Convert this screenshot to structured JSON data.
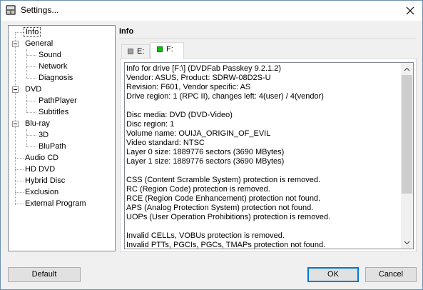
{
  "window": {
    "title": "Settings...",
    "close_label": "close"
  },
  "tree": {
    "items": [
      {
        "label": "Info",
        "selected": true
      },
      {
        "label": "General"
      },
      {
        "label": "Sound"
      },
      {
        "label": "Network"
      },
      {
        "label": "Diagnosis"
      },
      {
        "label": "DVD"
      },
      {
        "label": "PathPlayer"
      },
      {
        "label": "Subtitles"
      },
      {
        "label": "Blu-ray"
      },
      {
        "label": "3D"
      },
      {
        "label": "BluPath"
      },
      {
        "label": "Audio CD"
      },
      {
        "label": "HD DVD"
      },
      {
        "label": "Hybrid Disc"
      },
      {
        "label": "Exclusion"
      },
      {
        "label": "External Program"
      }
    ]
  },
  "panel": {
    "title": "Info"
  },
  "tabs": [
    {
      "label": "E:",
      "indicator_color": "#a0a0a0",
      "active": false
    },
    {
      "label": "F:",
      "indicator_color": "#00c800",
      "active": true
    }
  ],
  "info_lines": [
    "Info for drive [F:\\] (DVDFab Passkey 9.2.1.2)",
    "Vendor: ASUS, Product: SDRW-08D2S-U",
    "Revision: F601, Vendor specific: AS",
    "Drive region: 1 (RPC II), changes left: 4(user) / 4(vendor)",
    "",
    "Disc media: DVD (DVD-Video)",
    "Disc region: 1",
    "Volume name: OUIJA_ORIGIN_OF_EVIL",
    "Video standard: NTSC",
    "Layer 0 size: 1889776 sectors (3690 MBytes)",
    "Layer 1 size: 1889776 sectors (3690 MBytes)",
    "",
    "CSS (Content Scramble System) protection is removed.",
    "RC (Region Code) protection is removed.",
    "RCE (Region Code Enhancement) protection not found.",
    "APS (Analog Protection System) protection not found.",
    "UOPs (User Operation Prohibitions) protection is removed.",
    "",
    "Invalid CELLs, VOBUs protection is removed.",
    "Invalid PTTs, PGCIs, PGCs, TMAPs protection not found."
  ],
  "buttons": {
    "default": "Default",
    "ok": "OK",
    "cancel": "Cancel"
  }
}
